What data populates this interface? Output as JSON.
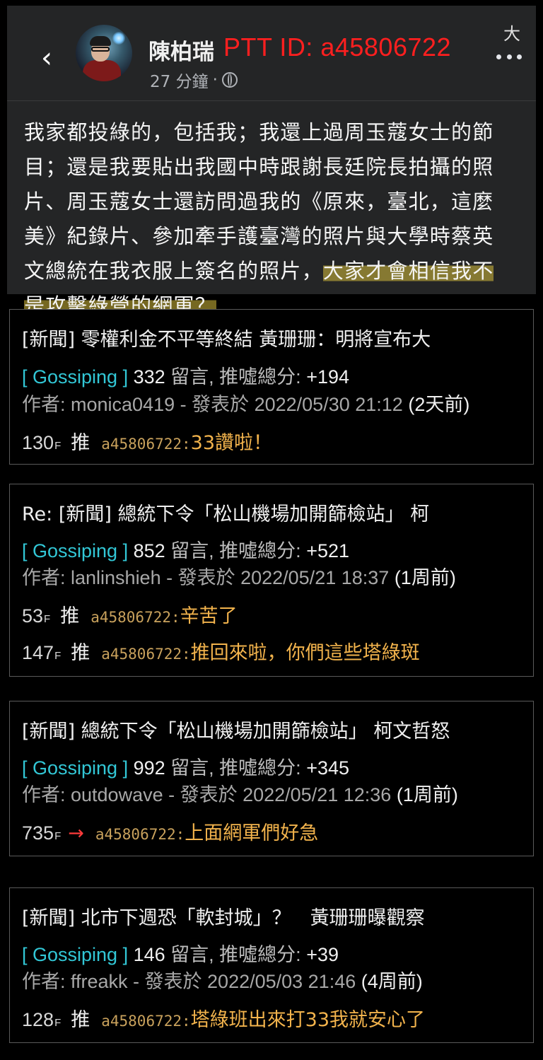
{
  "post": {
    "author": "陳柏瑞",
    "ptt_tag": "PTT ID: a45806722",
    "time": "27 分鐘",
    "dot": "·",
    "scribble_text": "大",
    "body_lines": [
      "我家都投綠的，包括我；我還上過周玉蔻女士的節",
      "目；還是我要貼出我國中時跟謝長廷院長拍攝的照",
      "片、周玉蔻女士還訪問過我的《原來，臺北，這麼",
      "美》紀錄片、參加牽手護臺灣的照片與大學時蔡英"
    ],
    "body_line5_plain": "文總統在我衣服上簽名的照片，",
    "body_line5_highlight": "大家才會相信我不",
    "body_line6_highlight": "是攻擊綠營的網軍？"
  },
  "articles": [
    {
      "title": "[新聞] 零權利金不平等終結 黃珊珊：明將宣布大",
      "board": "[ Gossiping ]",
      "count": "332",
      "count_label": "留言, 推噓總分:",
      "score": "+194",
      "author_line": "作者: monica0419 - 發表於 2022/05/30 21:12",
      "ago": "(2天前)",
      "pushes": [
        {
          "floor": "130",
          "floor_suffix": "F",
          "verb": "推",
          "uid": "a45806722:",
          "msg": "33讚啦！"
        }
      ]
    },
    {
      "title": "Re: [新聞] 總統下令「松山機場加開篩檢站」 柯",
      "board": "[ Gossiping ]",
      "count": "852",
      "count_label": "留言, 推噓總分:",
      "score": "+521",
      "author_line": "作者: lanlinshieh - 發表於 2022/05/21 18:37",
      "ago": "(1周前)",
      "pushes": [
        {
          "floor": "53",
          "floor_suffix": "F",
          "verb": "推",
          "uid": "a45806722:",
          "msg": "辛苦了"
        },
        {
          "floor": "147",
          "floor_suffix": "F",
          "verb": "推",
          "uid": "a45806722:",
          "msg": "推回來啦，你們這些塔綠斑"
        }
      ]
    },
    {
      "title": "[新聞] 總統下令「松山機場加開篩檢站」 柯文哲怒",
      "board": "[ Gossiping ]",
      "count": "992",
      "count_label": "留言, 推噓總分:",
      "score": "+345",
      "author_line": "作者: outdowave - 發表於 2022/05/21 12:36",
      "ago": "(1周前)",
      "pushes": [
        {
          "floor": "735",
          "floor_suffix": "F",
          "verb": "→",
          "uid": "a45806722:",
          "msg": "上面網軍們好急"
        }
      ]
    },
    {
      "title": "[新聞] 北市下週恐「軟封城」？　黃珊珊曝觀察",
      "board": "[ Gossiping ]",
      "count": "146",
      "count_label": "留言, 推噓總分:",
      "score": "+39",
      "author_line": "作者: ffreakk - 發表於 2022/05/03 21:46",
      "ago": "(4周前)",
      "pushes": [
        {
          "floor": "128",
          "floor_suffix": "F",
          "verb": "推",
          "uid": "a45806722:",
          "msg": "塔綠班出來打33我就安心了"
        }
      ]
    }
  ]
}
